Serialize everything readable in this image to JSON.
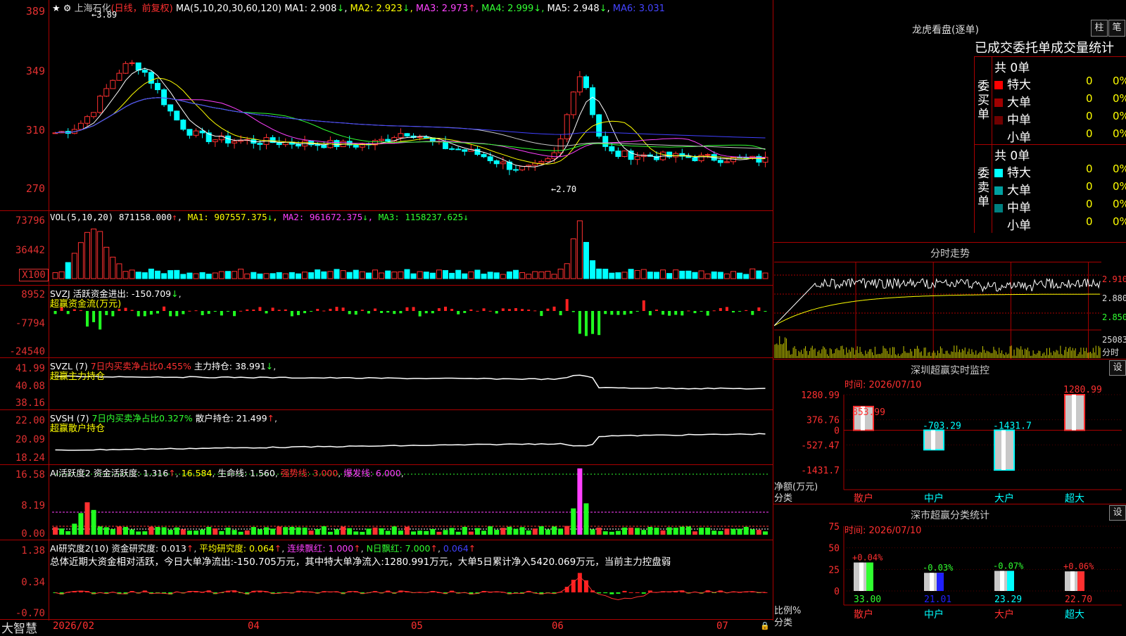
{
  "stock": {
    "name": "上海石化",
    "adjust": "(日线，前复权)",
    "ma_params": "MA(5,10,20,30,60,120)",
    "ma": [
      {
        "label": "MA1:",
        "value": "2.908",
        "trend": "↓",
        "color": "#ffffff"
      },
      {
        "label": "MA2:",
        "value": "2.923",
        "trend": "↓",
        "color": "#ffff00"
      },
      {
        "label": "MA3:",
        "value": "2.973",
        "trend": "↑",
        "color": "#ff40ff"
      },
      {
        "label": "MA4:",
        "value": "2.999",
        "trend": "↓",
        "color": "#30ff30"
      },
      {
        "label": "MA5:",
        "value": "2.948",
        "trend": "↓",
        "color": "#ffffff"
      },
      {
        "label": "MA6:",
        "value": "3.031",
        "trend": "",
        "color": "#4040ff"
      }
    ],
    "price_axis": [
      "389",
      "349",
      "310",
      "270"
    ],
    "high_mark": "3.89",
    "low_mark": "2.70"
  },
  "vol": {
    "header": "VOL(5,10,20)",
    "value": "871158.000",
    "ma1": "907557.375",
    "ma2": "961672.375",
    "ma3": "1158237.625",
    "axis": [
      "73796",
      "36442",
      "X100"
    ]
  },
  "svzj": {
    "header": "SVZJ",
    "label": "活跃资金进出:",
    "value": "-150.709",
    "sub": "超赢资金流(万元)",
    "axis": [
      "8952",
      "-7794",
      "-24540"
    ]
  },
  "svzl": {
    "header": "SVZL (7)",
    "label": "7日内买卖净占比0.455%",
    "label2": "主力持仓:",
    "value": "38.991",
    "sub": "超赢主力持仓",
    "axis": [
      "41.99",
      "40.08",
      "38.16"
    ]
  },
  "svsh": {
    "header": "SVSH (7)",
    "label": "7日内买卖净占比0.327%",
    "label2": "散户持仓:",
    "value": "21.499",
    "sub": "超赢散户持仓",
    "axis": [
      "22.00",
      "20.09",
      "18.24"
    ]
  },
  "ai1": {
    "header": "AI活跃度2",
    "label": "资金活跃度:",
    "value": "1.316",
    "value2": "16.584",
    "life_label": "生命线:",
    "life": "1.560",
    "strong": "强势线: 3.000",
    "burst": "爆发线: 6.000",
    "axis": [
      "16.58",
      "8.19",
      "0.00"
    ]
  },
  "ai2": {
    "header": "AI研究度2(10)",
    "label": "资金研究度:",
    "value": "0.013",
    "avg": "平均研究度: 0.064",
    "red1": "连续飘红: 1.000",
    "red2": "N日飘红: 7.000",
    "blue": "0.064",
    "summary": "总体近期大资金相对活跃，今日大单净流出:-150.705万元，其中特大单净流入:1280.991万元，大单5日累计净入5420.069万元，当前主力控盘弱",
    "axis": [
      "1.38",
      "0.34",
      "-0.70"
    ]
  },
  "xaxis": [
    "2026/02",
    "04",
    "05",
    "06",
    "07"
  ],
  "app_name": "大智慧",
  "dragon": {
    "title": "龙虎看盘(逐单)",
    "btn1": "柱",
    "btn2": "笔",
    "header": "已成交委托单成交量统计",
    "buy_label": "委买单",
    "sell_label": "委卖单",
    "buy_total": "共 0单",
    "sell_total": "共 0单",
    "buy_rows": [
      {
        "name": "特大",
        "count": "0",
        "pct": "0%",
        "color": "#ff0000"
      },
      {
        "name": "大单",
        "count": "0",
        "pct": "0%",
        "color": "#a00000"
      },
      {
        "name": "中单",
        "count": "0",
        "pct": "0%",
        "color": "#700000"
      },
      {
        "name": "小单",
        "count": "0",
        "pct": "0%",
        "color": ""
      }
    ],
    "sell_rows": [
      {
        "name": "特大",
        "count": "0",
        "pct": "0%",
        "color": "#00ffff"
      },
      {
        "name": "大单",
        "count": "0",
        "pct": "0%",
        "color": "#00a0a0"
      },
      {
        "name": "中单",
        "count": "0",
        "pct": "0%",
        "color": "#008080"
      },
      {
        "name": "小单",
        "count": "0",
        "pct": "0%",
        "color": ""
      }
    ]
  },
  "intraday": {
    "title": "分时走势",
    "axis": [
      "2.910",
      "2.880",
      "2.850"
    ],
    "vol_axis": [
      "25083",
      "分时"
    ]
  },
  "sz_monitor": {
    "title": "深圳超赢实时监控",
    "btn": "设",
    "time": "时间: 2026/07/10",
    "axis": [
      "1280.99",
      "376.76",
      "0",
      "-527.47",
      "-1431.7"
    ],
    "ylabel": "净额(万元)",
    "xlabel": "分类",
    "bars": [
      {
        "cat": "散户",
        "value": 853.99,
        "label": "853.99",
        "color": "#ff3030"
      },
      {
        "cat": "中户",
        "value": -703.29,
        "label": "-703.29",
        "color": "#00ffff"
      },
      {
        "cat": "大户",
        "value": -1431.7,
        "label": "-1431.7",
        "color": "#00ffff"
      },
      {
        "cat": "超大",
        "value": 1280.99,
        "label": "1280.99",
        "color": "#ff3030"
      }
    ]
  },
  "sz_classify": {
    "title": "深市超赢分类统计",
    "btn": "设",
    "time": "时间: 2026/07/10",
    "axis": [
      "75",
      "50",
      "25",
      "0"
    ],
    "ylabel": "比例%",
    "xlabel": "分类",
    "bars": [
      {
        "cat": "散户",
        "value": 33.0,
        "label": "33.00",
        "chg": "+0.04%",
        "color": "#30ff30",
        "chg_color": "#ff3030"
      },
      {
        "cat": "中户",
        "value": 21.01,
        "label": "21.01",
        "chg": "-0.03%",
        "color": "#2020ff",
        "chg_color": "#30ff30"
      },
      {
        "cat": "大户",
        "value": 23.29,
        "label": "23.29",
        "chg": "-0.07%",
        "color": "#00ffff",
        "chg_color": "#30ff30"
      },
      {
        "cat": "超大",
        "value": 22.7,
        "label": "22.70",
        "chg": "+0.06%",
        "color": "#ff3030",
        "chg_color": "#ff3030"
      }
    ]
  },
  "chart_data": [
    {
      "type": "bar",
      "title": "深圳超赢实时监控",
      "categories": [
        "散户",
        "中户",
        "大户",
        "超大"
      ],
      "values": [
        853.99,
        -703.29,
        -1431.7,
        1280.99
      ],
      "ylabel": "净额(万元)",
      "xlabel": "分类",
      "ylim": [
        -1431.7,
        1280.99
      ]
    },
    {
      "type": "bar",
      "title": "深市超赢分类统计",
      "categories": [
        "散户",
        "中户",
        "大户",
        "超大"
      ],
      "values": [
        33.0,
        21.01,
        23.29,
        22.7
      ],
      "ylabel": "比例%",
      "xlabel": "分类",
      "ylim": [
        0,
        75
      ]
    }
  ]
}
